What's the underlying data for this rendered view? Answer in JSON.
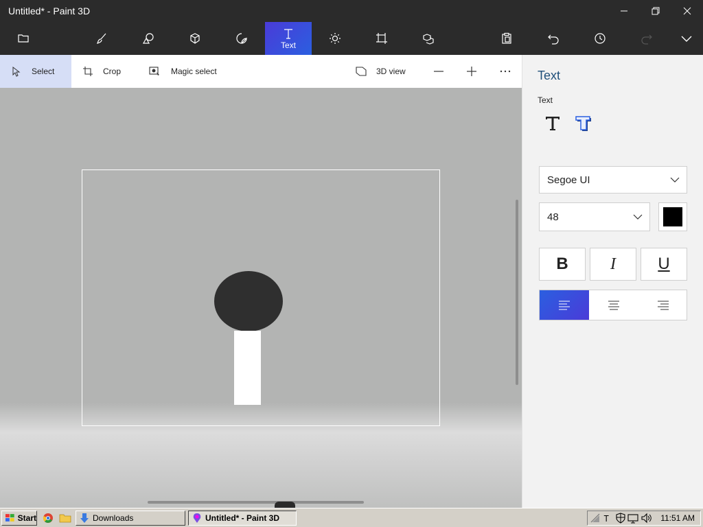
{
  "window": {
    "title": "Untitled* - Paint 3D",
    "minimize_icon": "minimize-icon",
    "restore_icon": "restore-icon",
    "close_icon": "close-icon"
  },
  "toolbar": {
    "active_label": "Text",
    "tools": [
      "menu-folder-icon",
      "brushes-icon",
      "2d-shapes-icon",
      "3d-shapes-icon",
      "stickers-icon",
      "text-icon",
      "effects-icon",
      "canvas-icon",
      "3d-library-icon",
      "paste-icon",
      "undo-icon",
      "history-icon",
      "redo-icon",
      "expand-chevron-icon"
    ]
  },
  "subbar": {
    "select_label": "Select",
    "crop_label": "Crop",
    "magic_select_label": "Magic select",
    "view3d_label": "3D view",
    "zoom_out_icon": "minus-icon",
    "zoom_in_icon": "plus-icon",
    "more_icon": "ellipsis-icon"
  },
  "panel": {
    "title": "Text",
    "text_section_label": "Text",
    "font_family": "Segoe UI",
    "font_size": "48",
    "color": "#000000",
    "bold_label": "B",
    "italic_label": "I",
    "underline_label": "U",
    "active_align": "left"
  },
  "colors": {
    "accent": "#3b4fe0",
    "titlebar": "#2b2b2b",
    "panel_title": "#1f4f7a"
  },
  "taskbar": {
    "start_label": "Start",
    "downloads_label": "Downloads",
    "paint_label": "Untitled* - Paint 3D",
    "clock": "11:51 AM"
  }
}
